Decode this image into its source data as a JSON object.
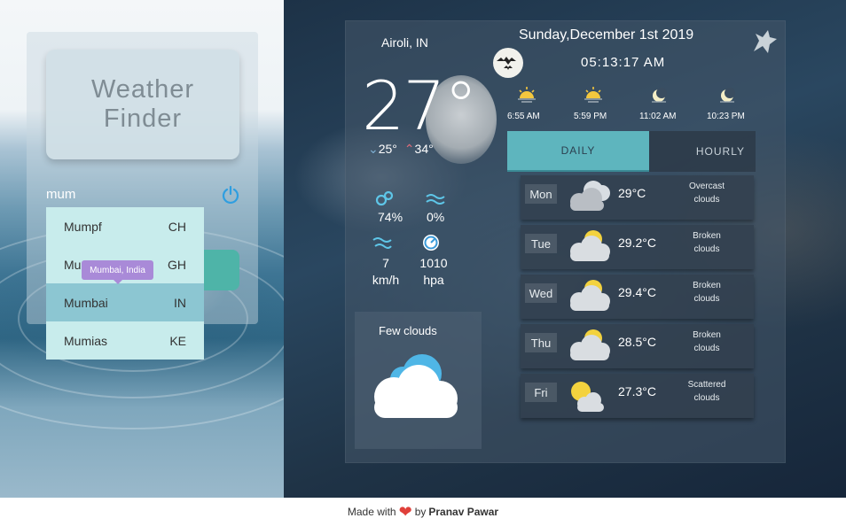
{
  "app": {
    "title_line1": "Weather",
    "title_line2": "Finder"
  },
  "search": {
    "value": "mum",
    "suggestions": [
      {
        "city": "Mumpf",
        "country": "CH"
      },
      {
        "city": "Mumford",
        "country": "GH"
      },
      {
        "city": "Mumbai",
        "country": "IN",
        "active": true
      },
      {
        "city": "Mumias",
        "country": "KE"
      }
    ],
    "tooltip": "Mumbai, India"
  },
  "current": {
    "location": "Airoli, IN",
    "temp": "27°",
    "min": "25°",
    "max": "34°",
    "humidity": "74%",
    "precip": "0%",
    "wind_value": "7",
    "wind_unit": "km/h",
    "pressure_value": "1010",
    "pressure_unit": "hpa",
    "condition": "Few clouds"
  },
  "header": {
    "date": "Sunday,December 1st 2019",
    "time": "05:13:17 AM"
  },
  "sun_moon": [
    {
      "time": "6:55 AM",
      "icon": "sunrise-icon"
    },
    {
      "time": "5:59 PM",
      "icon": "sunset-icon"
    },
    {
      "time": "11:02 AM",
      "icon": "moonrise-icon"
    },
    {
      "time": "10:23 PM",
      "icon": "moonset-icon"
    }
  ],
  "tabs": {
    "daily": "DAILY",
    "hourly": "HOURLY"
  },
  "forecast": [
    {
      "day": "Mon",
      "temp": "29°C",
      "cond1": "Overcast",
      "cond2": "clouds",
      "icon": "overcast-clouds-icon"
    },
    {
      "day": "Tue",
      "temp": "29.2°C",
      "cond1": "Broken",
      "cond2": "clouds",
      "icon": "broken-clouds-icon"
    },
    {
      "day": "Wed",
      "temp": "29.4°C",
      "cond1": "Broken",
      "cond2": "clouds",
      "icon": "broken-clouds-icon"
    },
    {
      "day": "Thu",
      "temp": "28.5°C",
      "cond1": "Broken",
      "cond2": "clouds",
      "icon": "broken-clouds-icon"
    },
    {
      "day": "Fri",
      "temp": "27.3°C",
      "cond1": "Scattered",
      "cond2": "clouds",
      "icon": "scattered-clouds-icon"
    }
  ],
  "footer": {
    "prefix": "Made with",
    "by": "by",
    "author": "Pranav Pawar"
  },
  "colors": {
    "accent_teal": "#5eb5be",
    "suggest_bg": "#c8ecec",
    "suggest_active": "#8cc6d2",
    "tooltip": "#a98ad8",
    "heart": "#e0403a",
    "sun": "#f3d23e"
  }
}
